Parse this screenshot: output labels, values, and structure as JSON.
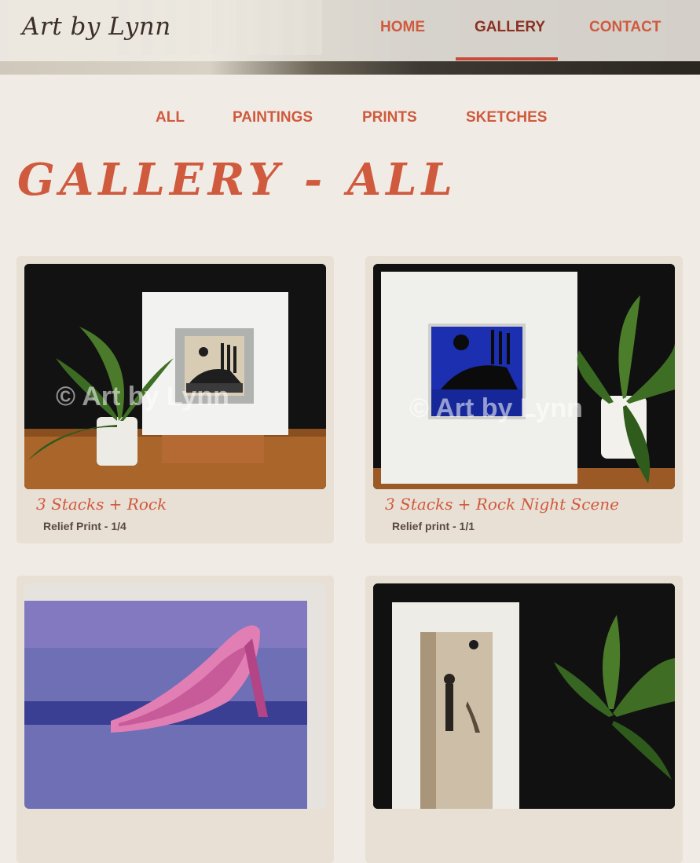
{
  "site": {
    "logo": "Art by Lynn"
  },
  "nav": {
    "items": [
      {
        "label": "HOME"
      },
      {
        "label": "GALLERY",
        "active": true
      },
      {
        "label": "CONTACT"
      }
    ]
  },
  "filters": {
    "items": [
      {
        "label": "ALL"
      },
      {
        "label": "PAINTINGS"
      },
      {
        "label": "PRINTS"
      },
      {
        "label": "SKETCHES"
      }
    ]
  },
  "page": {
    "title": "GALLERY - ALL"
  },
  "gallery": {
    "watermark": "© Art by Lynn",
    "items": [
      {
        "title": "3 Stacks + Rock",
        "subtitle": "Relief Print - 1/4"
      },
      {
        "title": "3 Stacks + Rock Night Scene",
        "subtitle": "Relief print - 1/1"
      },
      {
        "title": "",
        "subtitle": ""
      },
      {
        "title": "",
        "subtitle": ""
      }
    ]
  },
  "colors": {
    "accent": "#cf5a3e",
    "accent_dark": "#8b3122",
    "background": "#f0ece5",
    "card": "#e8e0d5"
  }
}
